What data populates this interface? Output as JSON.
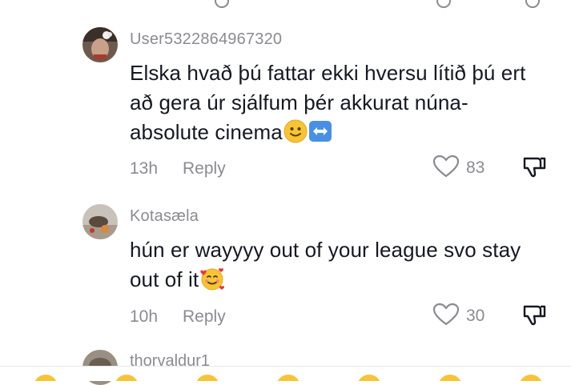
{
  "comments": [
    {
      "username": "User5322864967320",
      "text": "Elska hvað þú fattar ekki hversu lítið þú ert að gera úr sjálfum þér akkurat núna- absolute cinema",
      "emojis": [
        "slightly-smiling-face",
        "left-right-arrow"
      ],
      "time": "13h",
      "reply_label": "Reply",
      "likes": "83"
    },
    {
      "username": "Kotasæla",
      "text": "hún er wayyyy out of your league svo stay out of it",
      "emojis": [
        "smiling-face-with-hearts"
      ],
      "time": "10h",
      "reply_label": "Reply",
      "likes": "30"
    },
    {
      "username": "thorvaldur1"
    }
  ],
  "icons": {
    "like": "heart-outline-icon",
    "dislike": "thumbs-down-icon"
  },
  "colors": {
    "text": "#161823",
    "muted": "#8a8b91",
    "emoji_yellow": "#f7c438",
    "arrow_blue": "#4a90e2"
  }
}
